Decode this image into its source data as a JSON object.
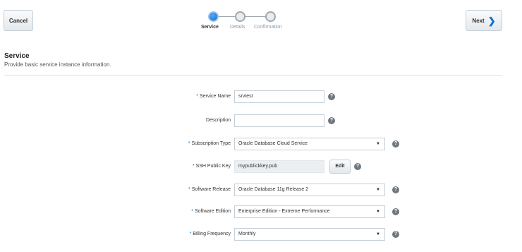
{
  "header": {
    "cancel_label": "Cancel",
    "next_label": "Next",
    "train": {
      "stops": [
        {
          "label": "Service",
          "state": "active"
        },
        {
          "label": "Details",
          "state": "inactive"
        },
        {
          "label": "Confirmation",
          "state": "inactive"
        }
      ]
    }
  },
  "section": {
    "title": "Service",
    "description": "Provide basic service instance information."
  },
  "form": {
    "required_marker": "*",
    "service_name": {
      "label": "Service Name",
      "value": "srvtest",
      "required": true
    },
    "description": {
      "label": "Description",
      "value": "",
      "required": false
    },
    "subscription_type": {
      "label": "Subscription Type",
      "value": "Oracle Database Cloud Service",
      "required": true
    },
    "ssh_public_key": {
      "label": "SSH Public Key",
      "value": "mypublickkey.pub",
      "required": true,
      "edit_label": "Edit"
    },
    "software_release": {
      "label": "Software Release",
      "value": "Oracle Database 11g Release 2",
      "required": true
    },
    "software_edition": {
      "label": "Software Edition",
      "value": "Enterprise Edition - Extreme Performance",
      "required": true
    },
    "billing_frequency": {
      "label": "Billing Frequency",
      "value": "Monthly",
      "required": true
    }
  },
  "icons": {
    "help": "question-circle-icon",
    "next": "chevron-right-icon",
    "dropdown": "caret-down-icon"
  },
  "colors": {
    "accent": "#0572ce",
    "help_icon": "#6f7880"
  }
}
